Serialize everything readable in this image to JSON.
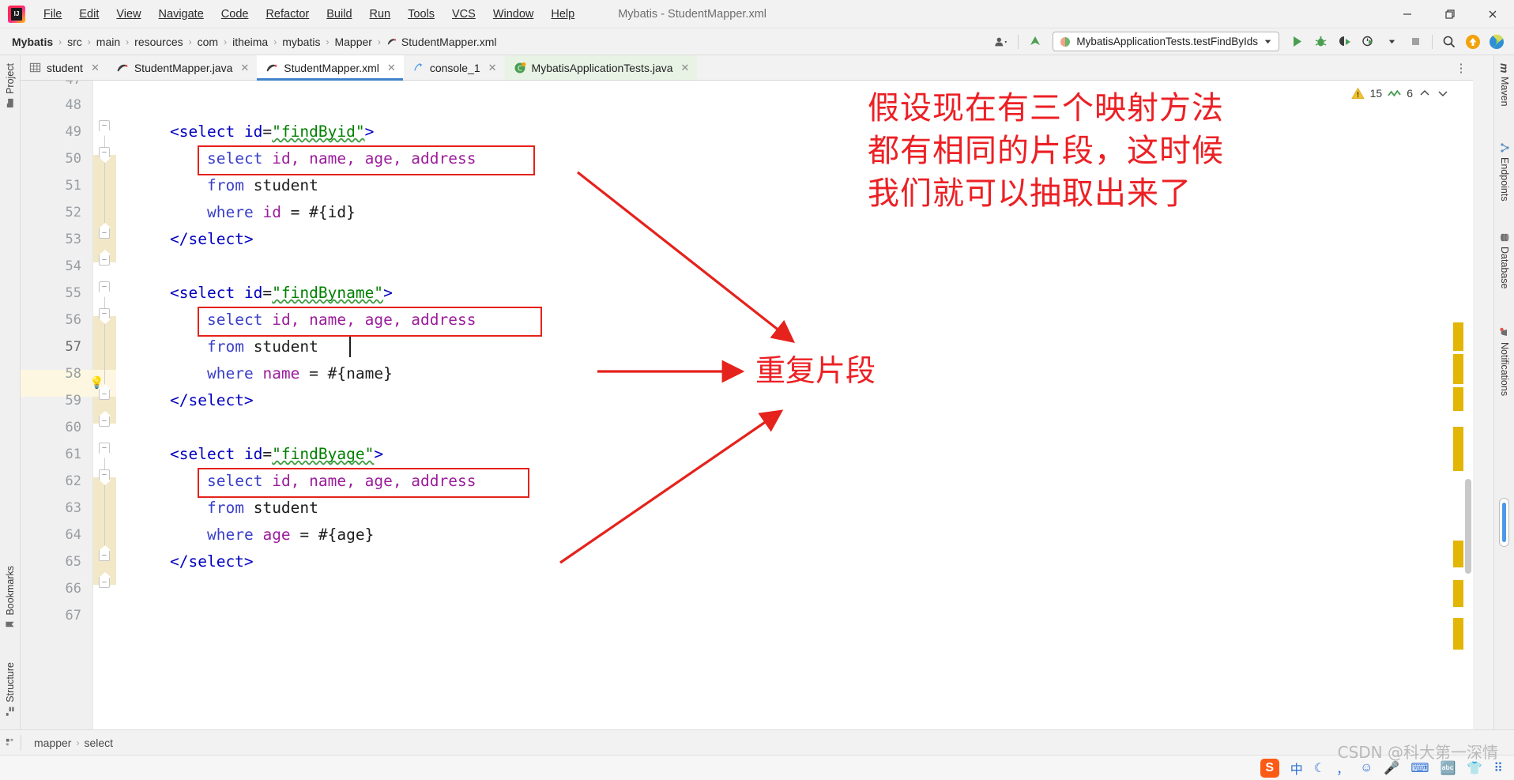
{
  "window": {
    "title": "Mybatis - StudentMapper.xml",
    "logo_text": "IJ",
    "minimize": "—",
    "maximize": "❐",
    "close": "✕"
  },
  "menubar": {
    "items": [
      {
        "label": "File"
      },
      {
        "label": "Edit"
      },
      {
        "label": "View"
      },
      {
        "label": "Navigate"
      },
      {
        "label": "Code"
      },
      {
        "label": "Refactor"
      },
      {
        "label": "Build"
      },
      {
        "label": "Run"
      },
      {
        "label": "Tools"
      },
      {
        "label": "VCS"
      },
      {
        "label": "Window"
      },
      {
        "label": "Help"
      }
    ]
  },
  "breadcrumb": {
    "separator": "›",
    "items": [
      {
        "label": "Mybatis"
      },
      {
        "label": "src"
      },
      {
        "label": "main"
      },
      {
        "label": "resources"
      },
      {
        "label": "com"
      },
      {
        "label": "itheima"
      },
      {
        "label": "mybatis"
      },
      {
        "label": "Mapper"
      },
      {
        "label": "StudentMapper.xml"
      }
    ]
  },
  "toolbar": {
    "run_config": "MybatisApplicationTests.testFindByIds",
    "run_label": "Run",
    "debug_label": "Debug",
    "coverage_label": "Run with Coverage",
    "profile_label": "Profiler",
    "stop_label": "Stop",
    "search_label": "Search Everywhere",
    "update_label": "Update Project",
    "settings_label": "Settings"
  },
  "tabs": [
    {
      "label": "student",
      "icon": "table-icon",
      "active": false,
      "style": "plain"
    },
    {
      "label": "StudentMapper.java",
      "icon": "xml-file-icon",
      "active": false,
      "style": "plain"
    },
    {
      "label": "StudentMapper.xml",
      "icon": "xml-file-icon",
      "active": true,
      "style": "plain"
    },
    {
      "label": "console_1",
      "icon": "console-icon",
      "active": false,
      "style": "plain"
    },
    {
      "label": "MybatisApplicationTests.java",
      "icon": "class-icon",
      "active": false,
      "style": "green"
    }
  ],
  "inspections": {
    "warning_icon": "warning-triangle-icon",
    "warning_count": "15",
    "weak_warning_icon": "weak-warning-icon",
    "weak_warning_count": "6",
    "prev_label": "Previous Highlighted Error",
    "next_label": "Next Highlighted Error"
  },
  "left_strip": {
    "items": [
      {
        "label": "Project",
        "icon": "project-folder-icon"
      },
      {
        "label": "Bookmarks",
        "icon": "bookmark-icon"
      },
      {
        "label": "Structure",
        "icon": "structure-icon"
      }
    ]
  },
  "right_strip": {
    "items": [
      {
        "label": "Maven",
        "icon": "maven-icon"
      },
      {
        "label": "Endpoints",
        "icon": "endpoints-icon"
      },
      {
        "label": "Database",
        "icon": "database-icon"
      },
      {
        "label": "Notifications",
        "icon": "notifications-icon"
      }
    ]
  },
  "editor": {
    "first_line": 47,
    "lines": [
      {
        "n": 47,
        "text": "",
        "partial": true
      },
      {
        "n": 48,
        "text": ""
      },
      {
        "n": 49,
        "text": "<select id=\"findByid\">"
      },
      {
        "n": 50,
        "text": "    select id, name, age, address"
      },
      {
        "n": 51,
        "text": "    from student"
      },
      {
        "n": 52,
        "text": "    where id = #{id}"
      },
      {
        "n": 53,
        "text": "</select>"
      },
      {
        "n": 54,
        "text": ""
      },
      {
        "n": 55,
        "text": "<select id=\"findByname\">"
      },
      {
        "n": 56,
        "text": "    select id, name, age, address"
      },
      {
        "n": 57,
        "text": "    from student"
      },
      {
        "n": 58,
        "text": "    where name = #{name}"
      },
      {
        "n": 59,
        "text": "</select>"
      },
      {
        "n": 60,
        "text": ""
      },
      {
        "n": 61,
        "text": "<select id=\"findByage\">"
      },
      {
        "n": 62,
        "text": "    select id, name, age, address"
      },
      {
        "n": 63,
        "text": "    from student"
      },
      {
        "n": 64,
        "text": "    where age = #{age}"
      },
      {
        "n": 65,
        "text": "</select>"
      },
      {
        "n": 66,
        "text": ""
      },
      {
        "n": 67,
        "text": ""
      }
    ],
    "caret_line": 57,
    "columns_fragment": "id, name, age, address",
    "tokens": {
      "tag_open": "<select",
      "tag_close": "</select>",
      "attr_name": "id",
      "attr_values": [
        "\"findByid\"",
        "\"findByname\"",
        "\"findByage\""
      ],
      "kw_select": "select",
      "kw_from": "from",
      "kw_where": "where",
      "table": "student",
      "params": [
        "#{id}",
        "#{name}",
        "#{age}"
      ]
    },
    "intention_bulb": "lightbulb-icon"
  },
  "annotations": {
    "note_lines": [
      "假设现在有三个映射方法",
      "都有相同的片段，这时候",
      "我们就可以抽取出来了"
    ],
    "label": "重复片段",
    "color": "#ec2024",
    "box_color": "#e5221b"
  },
  "status_bar": {
    "crumbs": [
      "mapper",
      "select"
    ],
    "separator": "›"
  },
  "taskbar": {
    "sogou_label": "S",
    "tray_icons": [
      "ime-chinese-icon",
      "moon-icon",
      "punctuation-icon",
      "emoji-icon",
      "mic-icon",
      "keyboard-icon",
      "abc-icon",
      "skin-icon",
      "apps-icon"
    ],
    "watermark": "CSDN @科大第一深情"
  },
  "colors": {
    "accent": "#4083c9",
    "highlight_band": "#f2e8c7",
    "current_line": "#fdf7e2",
    "tag": "#0000c0",
    "value": "#008000",
    "keyword": "#3a40c8",
    "column": "#9b1d9b",
    "marker": "#e3b505"
  }
}
